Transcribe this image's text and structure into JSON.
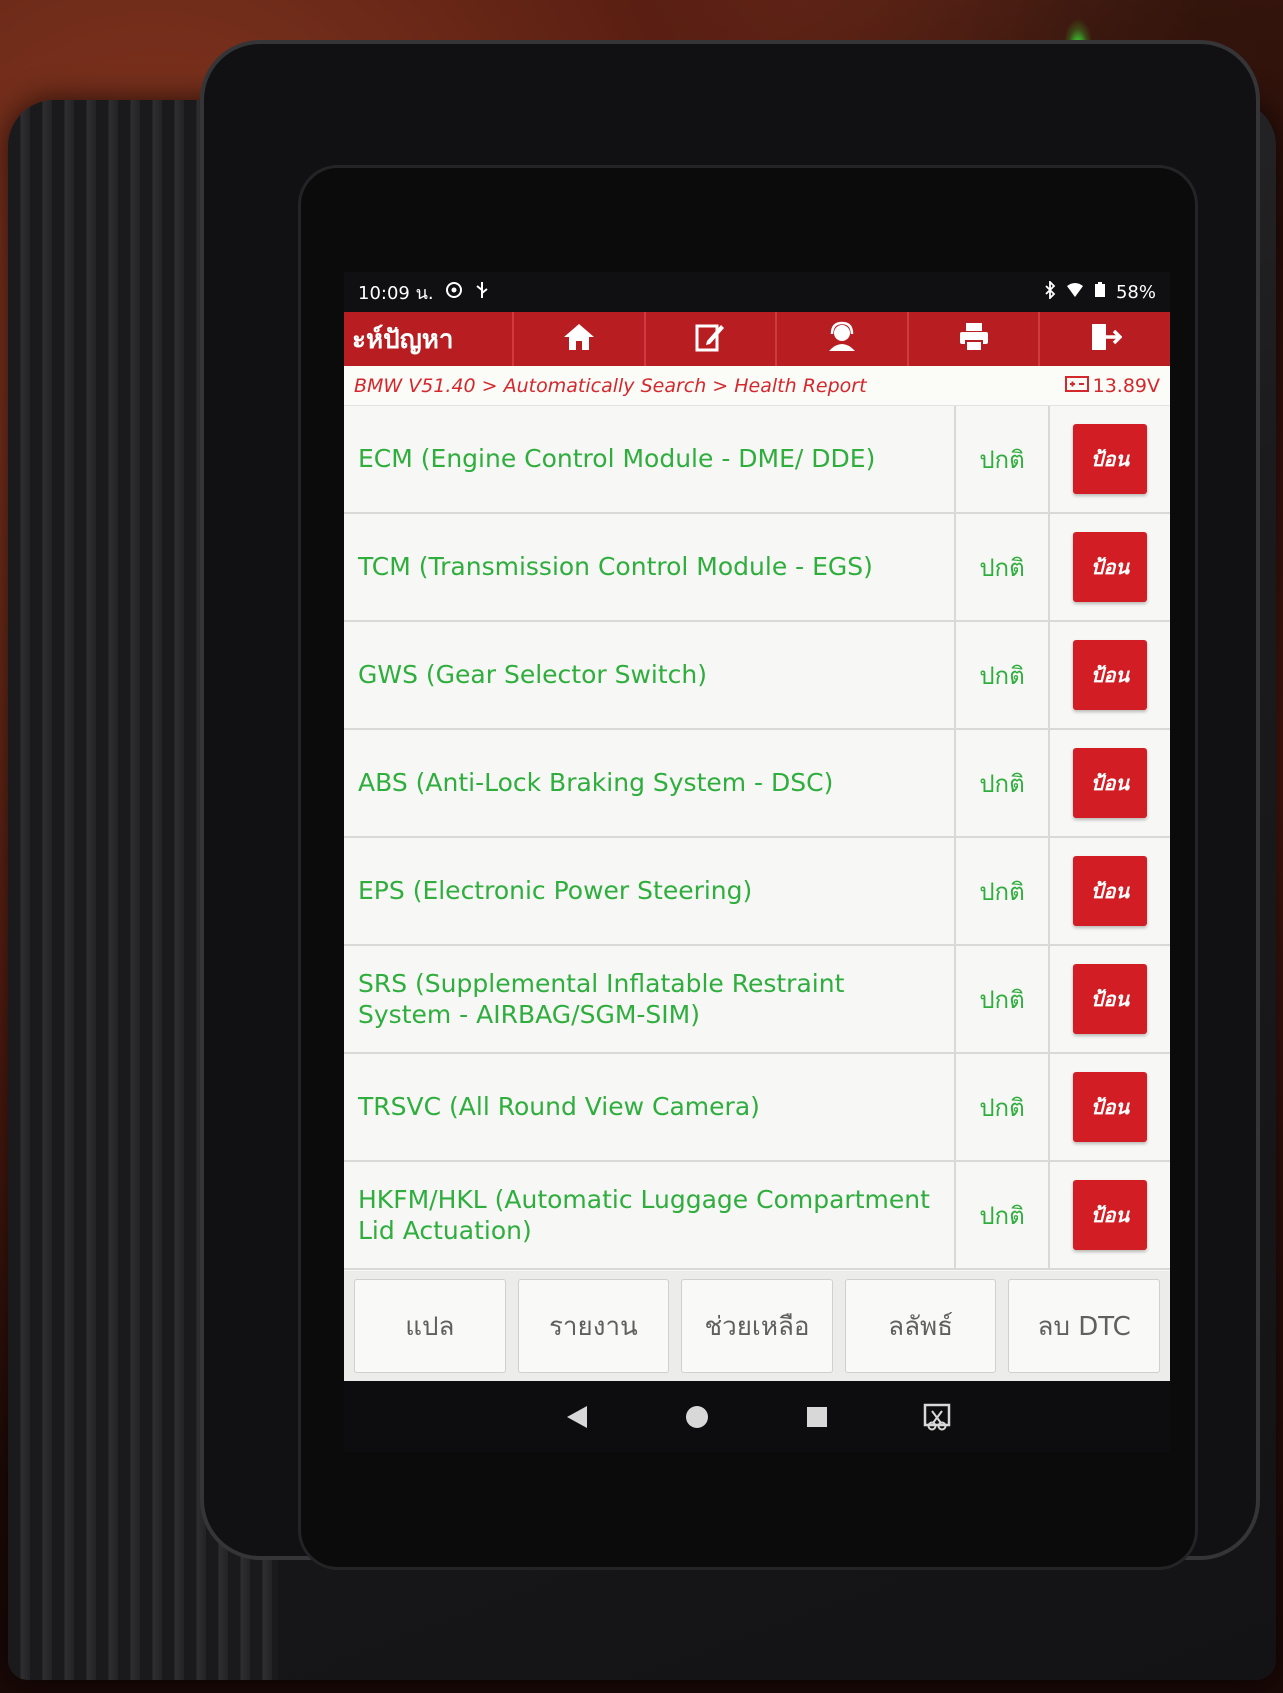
{
  "status_bar": {
    "time": "10:09 น.",
    "battery": "58%"
  },
  "toolbar": {
    "title": "ะห์ปัญหา",
    "icons": [
      "home-icon",
      "edit-icon",
      "support-icon",
      "print-icon",
      "exit-icon"
    ]
  },
  "breadcrumb": {
    "path": "BMW V51.40 > Automatically Search > Health Report",
    "voltage": "13.89V"
  },
  "modules": [
    {
      "name": "ECM (Engine Control Module - DME/ DDE)",
      "status": "ปกติ",
      "action": "ป้อน"
    },
    {
      "name": "TCM (Transmission Control Module - EGS)",
      "status": "ปกติ",
      "action": "ป้อน"
    },
    {
      "name": "GWS (Gear Selector Switch)",
      "status": "ปกติ",
      "action": "ป้อน"
    },
    {
      "name": "ABS (Anti-Lock Braking System - DSC)",
      "status": "ปกติ",
      "action": "ป้อน"
    },
    {
      "name": "EPS (Electronic Power Steering)",
      "status": "ปกติ",
      "action": "ป้อน"
    },
    {
      "name": "SRS (Supplemental Inflatable Restraint System - AIRBAG/SGM-SIM)",
      "status": "ปกติ",
      "action": "ป้อน"
    },
    {
      "name": "TRSVC (All Round View Camera)",
      "status": "ปกติ",
      "action": "ป้อน"
    },
    {
      "name": "HKFM/HKL (Automatic Luggage Compartment Lid Actuation)",
      "status": "ปกติ",
      "action": "ป้อน"
    }
  ],
  "bottom_buttons": {
    "translate": "แปล",
    "report": "รายงาน",
    "help": "ช่วยเหลือ",
    "clear_results": "ลลัพธ์",
    "clear_dtc": "ลบ DTC"
  },
  "colors": {
    "toolbar": "#b81d22",
    "module_text": "#2fae3e",
    "enter_button": "#d21d24"
  }
}
